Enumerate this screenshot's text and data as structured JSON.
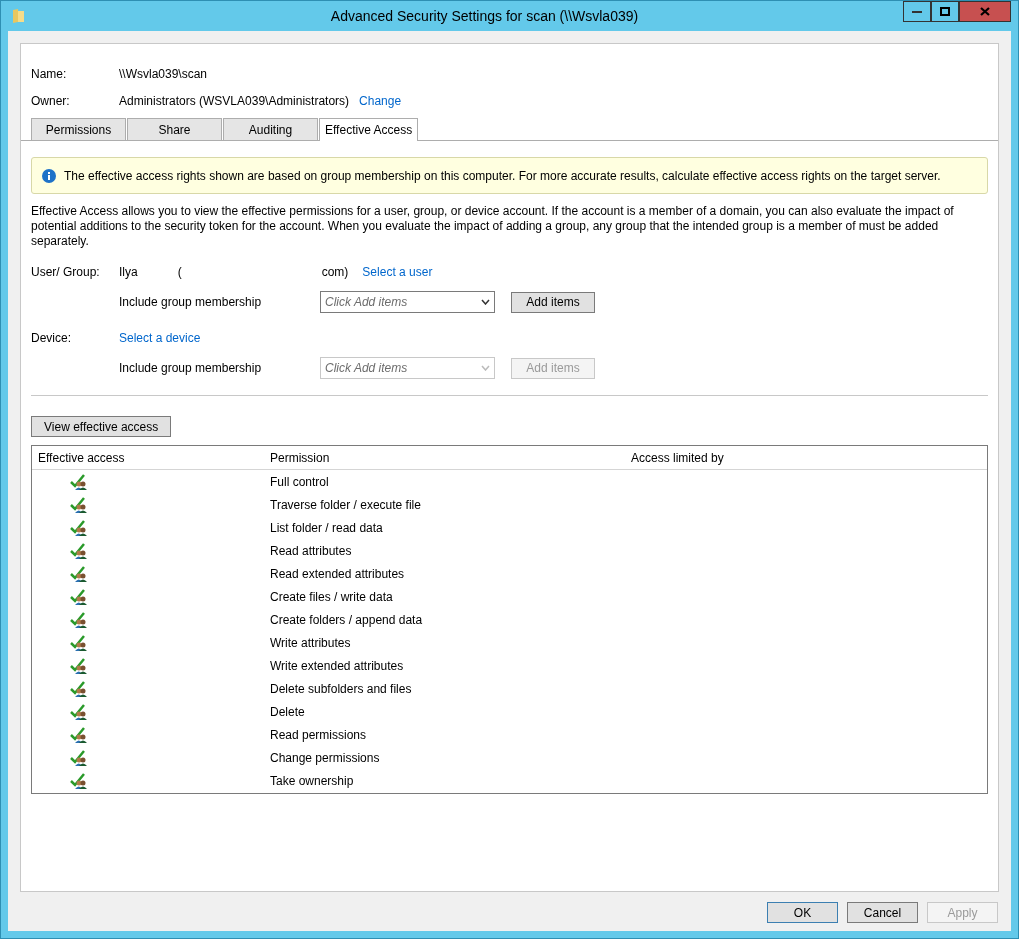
{
  "window": {
    "title": "Advanced Security Settings for scan (\\\\Wsvla039)"
  },
  "name": {
    "label": "Name:",
    "value": "\\\\Wsvla039\\scan"
  },
  "owner": {
    "label": "Owner:",
    "value": "Administrators (WSVLA039\\Administrators)",
    "link": "Change"
  },
  "tabs": [
    {
      "label": "Permissions",
      "selected": false
    },
    {
      "label": "Share",
      "selected": false
    },
    {
      "label": "Auditing",
      "selected": false
    },
    {
      "label": "Effective Access",
      "selected": true
    }
  ],
  "info_banner": "The effective access rights shown are based on group membership on this computer. For more accurate results, calculate effective access rights on the target server.",
  "description": "Effective Access allows you to view the effective permissions for a user, group, or device account. If the account is a member of a domain, you can also evaluate the impact of potential additions to the security token for the account. When you evaluate the impact of adding a group, any group that the intended group is a member of must be added separately.",
  "principals": [
    {
      "label": "User/ Group:",
      "value_parts": [
        "Ilya",
        "(",
        "com)"
      ],
      "link": "Select a user",
      "group_label": "Include group membership",
      "dropdown_placeholder": "Click Add items",
      "add_button": "Add items",
      "disabled": false
    },
    {
      "label": "Device:",
      "link": "Select a device",
      "group_label": "Include group membership",
      "dropdown_placeholder": "Click Add items",
      "add_button": "Add items",
      "disabled": true
    }
  ],
  "view_button": "View effective access",
  "table": {
    "columns": [
      "Effective access",
      "Permission",
      "Access limited by"
    ],
    "rows": [
      {
        "allowed": true,
        "permission": "Full control"
      },
      {
        "allowed": true,
        "permission": "Traverse folder / execute file"
      },
      {
        "allowed": true,
        "permission": "List folder / read data"
      },
      {
        "allowed": true,
        "permission": "Read attributes"
      },
      {
        "allowed": true,
        "permission": "Read extended attributes"
      },
      {
        "allowed": true,
        "permission": "Create files / write data"
      },
      {
        "allowed": true,
        "permission": "Create folders / append data"
      },
      {
        "allowed": true,
        "permission": "Write attributes"
      },
      {
        "allowed": true,
        "permission": "Write extended attributes"
      },
      {
        "allowed": true,
        "permission": "Delete subfolders and files"
      },
      {
        "allowed": true,
        "permission": "Delete"
      },
      {
        "allowed": true,
        "permission": "Read permissions"
      },
      {
        "allowed": true,
        "permission": "Change permissions"
      },
      {
        "allowed": true,
        "permission": "Take ownership"
      }
    ]
  },
  "buttons": [
    {
      "label": "OK",
      "disabled": false,
      "default": true
    },
    {
      "label": "Cancel",
      "disabled": false,
      "default": false
    },
    {
      "label": "Apply",
      "disabled": true,
      "default": false
    }
  ]
}
